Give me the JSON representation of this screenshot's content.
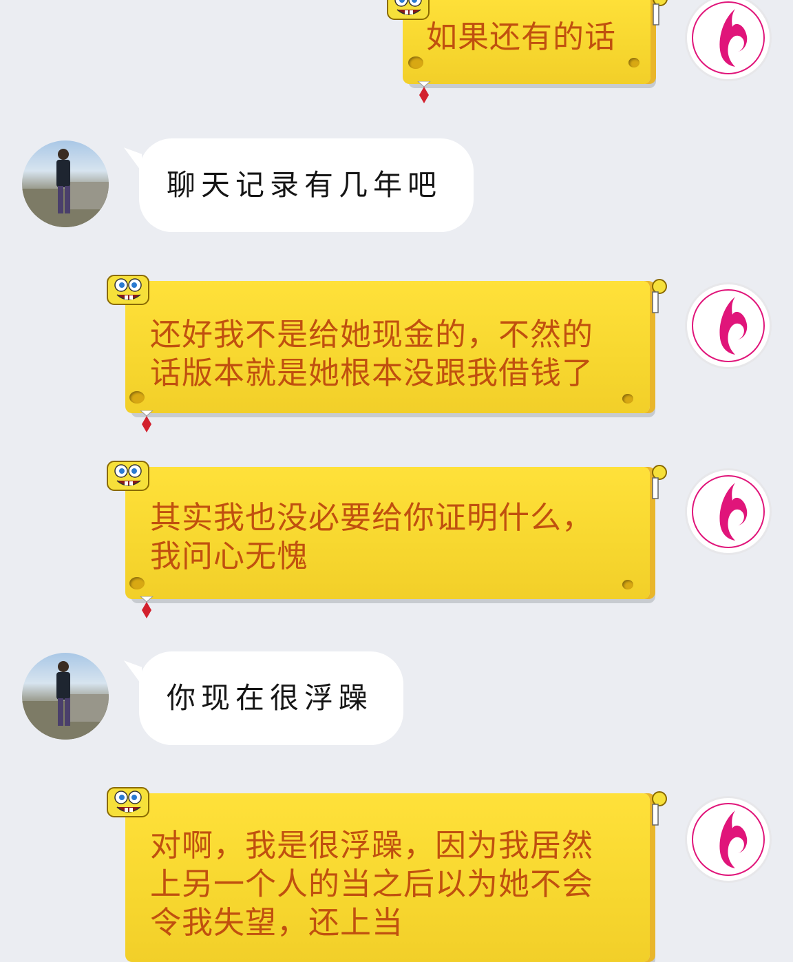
{
  "messages": [
    {
      "sender": "self",
      "text": "如果还有的话",
      "bubble_style": "spongebob-yellow"
    },
    {
      "sender": "peer",
      "text": "聊天记录有几年吧",
      "bubble_style": "white"
    },
    {
      "sender": "self",
      "lines": [
        "还好我不是给她现金的，不然的",
        "话版本就是她根本没跟我借钱了"
      ],
      "bubble_style": "spongebob-yellow"
    },
    {
      "sender": "self",
      "lines": [
        "其实我也没必要给你证明什么，",
        "我问心无愧"
      ],
      "bubble_style": "spongebob-yellow"
    },
    {
      "sender": "peer",
      "text": "你现在很浮躁",
      "bubble_style": "white"
    },
    {
      "sender": "self",
      "lines": [
        "对啊，我是很浮躁，因为我居然",
        "上另一个人的当之后以为她不会",
        "令我失望，还上当"
      ],
      "bubble_style": "spongebob-yellow"
    }
  ],
  "colors": {
    "background": "#ebedf2",
    "yellow_bubble": "#f7d72f",
    "yellow_text": "#c0500f",
    "white_bubble": "#ffffff",
    "self_avatar_logo": "#e0157a"
  },
  "icons": {
    "self_avatar": "pink-woman-profile-logo-icon",
    "peer_avatar": "person-photo-avatar",
    "bubble_decoration": "spongebob-icon"
  }
}
